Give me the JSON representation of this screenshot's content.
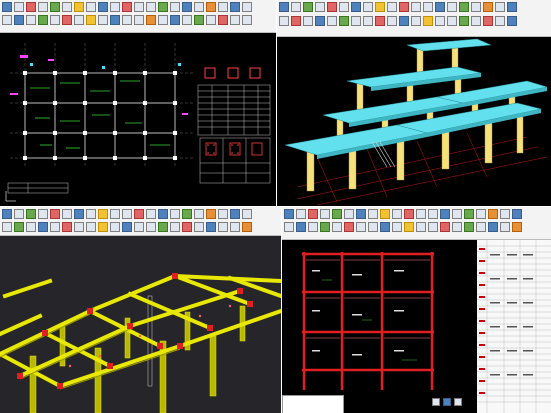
{
  "panes": [
    {
      "name": "plan-drawing",
      "ribbon_groups": [
        "",
        "",
        ""
      ]
    },
    {
      "name": "3d-solid-model",
      "ribbon_groups": [
        "",
        ""
      ]
    },
    {
      "name": "3d-frame-model",
      "ribbon_groups": [
        "",
        "",
        ""
      ]
    },
    {
      "name": "elevation-drawing",
      "ribbon_groups": [
        "",
        ""
      ]
    }
  ],
  "colors": {
    "cad_background": "#000000",
    "slab_cyan": "#62e0ee",
    "column_yellow": "#f5e07a",
    "frame_yellow": "#e8e800",
    "rebar_red": "#e02020",
    "ribbon_bg": "#f3f3f3"
  }
}
